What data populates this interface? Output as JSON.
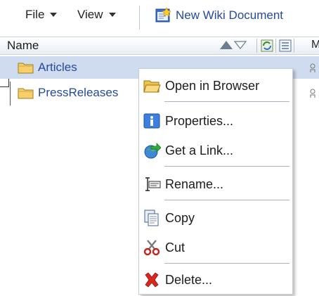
{
  "toolbar": {
    "file_label": "File",
    "view_label": "View",
    "new_wiki_label": "New Wiki Document"
  },
  "table": {
    "header_name": "Name",
    "header_cut": "M",
    "rows": [
      {
        "label": "Articles",
        "selected": true
      },
      {
        "label": "PressReleases",
        "selected": false
      }
    ]
  },
  "context_menu": {
    "items": [
      {
        "label": "Open in Browser",
        "icon": "folder-open-icon"
      },
      {
        "label": "Properties...",
        "icon": "info-icon"
      },
      {
        "label": "Get a Link...",
        "icon": "globe-link-icon"
      },
      {
        "label": "Rename...",
        "icon": "rename-icon"
      },
      {
        "label": "Copy",
        "icon": "copy-icon"
      },
      {
        "label": "Cut",
        "icon": "scissors-icon"
      },
      {
        "label": "Delete...",
        "icon": "delete-x-icon"
      }
    ]
  },
  "colors": {
    "link_blue": "#234a9c",
    "selected_row": "#cfdcef",
    "delete_red": "#d8271c"
  }
}
